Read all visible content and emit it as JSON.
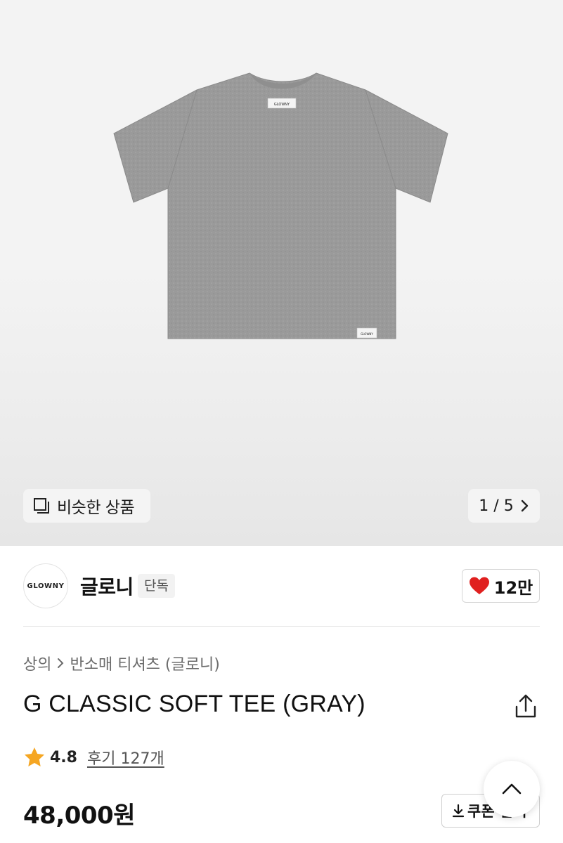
{
  "gallery": {
    "similar_label": "비슷한 상품",
    "current_page": "1",
    "total_pages": "5",
    "page_separator": " / ",
    "product_image_alt": "gray t-shirt"
  },
  "brand": {
    "logo_text": "GLOWNY",
    "name": "글로니",
    "badge": "단독",
    "like_count": "12만",
    "accent_color": "#e0201f"
  },
  "breadcrumb": {
    "items": [
      "상의",
      "반소매 티셔츠 (글로니)"
    ]
  },
  "product": {
    "title": "G CLASSIC SOFT TEE (GRAY)",
    "rating": "4.8",
    "reviews_label": "후기 127개",
    "price": "48,000원",
    "coupon_label": "쿠폰 받기"
  },
  "icons": {
    "similar": "squares-icon",
    "pager_next": "chevron-right-icon",
    "like": "heart-icon",
    "share": "share-icon",
    "star": "star-icon",
    "download": "download-icon",
    "scroll_top": "chevron-up-icon"
  }
}
